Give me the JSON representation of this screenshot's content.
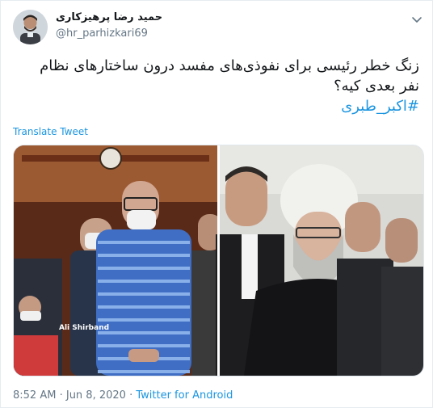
{
  "author": {
    "display_name": "حمید رضا پرهیزکاری",
    "handle": "@hr_parhizkari69",
    "avatar_icon": "avatar-photo"
  },
  "tweet": {
    "line1": "زنگ خطر رئیسی برای نفوذی‌های مفسد درون ساختارهای نظام",
    "line2": "نفر بعدی کیه؟",
    "hashtag": "#اکبر_طبری",
    "translate_label": "Translate Tweet"
  },
  "media": {
    "left_photo_credit": "Ali Shirband",
    "icons": [
      "photo-left-icon",
      "photo-right-icon"
    ]
  },
  "footer": {
    "time": "8:52 AM",
    "separator": "·",
    "date": "Jun 8, 2020",
    "source": "Twitter for Android"
  },
  "colors": {
    "link": "#1b95e0",
    "muted": "#657786",
    "text": "#14171a"
  }
}
